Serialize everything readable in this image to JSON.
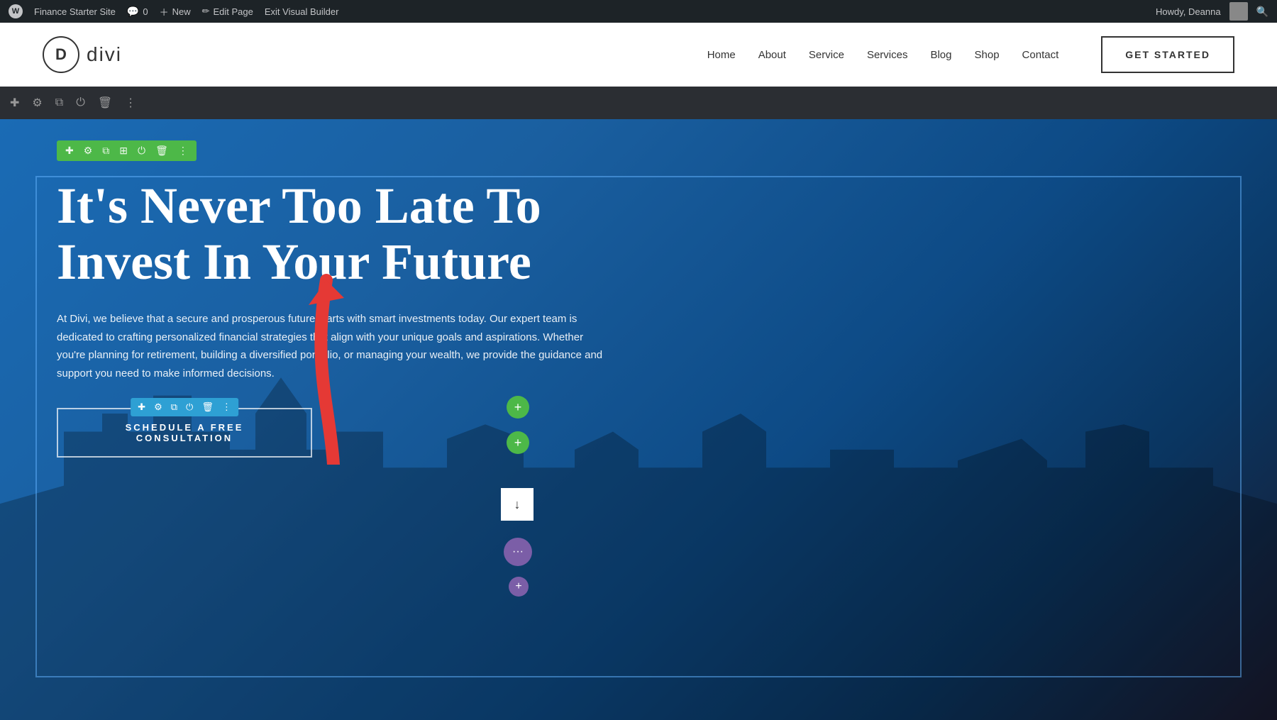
{
  "admin_bar": {
    "wp_icon": "W",
    "site_name": "Finance Starter Site",
    "comments_label": "0",
    "new_label": "New",
    "edit_page_label": "Edit Page",
    "exit_builder_label": "Exit Visual Builder",
    "howdy_label": "Howdy, Deanna"
  },
  "header": {
    "logo_letter": "D",
    "logo_text": "divi",
    "nav_items": [
      "Home",
      "About",
      "Service",
      "Services",
      "Blog",
      "Shop",
      "Contact"
    ],
    "cta_label": "GET STARTED"
  },
  "builder_bar": {
    "icons": [
      "plus",
      "gear",
      "copy",
      "power",
      "trash",
      "menu"
    ]
  },
  "hero": {
    "title": "It's Never Too Late To Invest In Your Future",
    "description": "At Divi, we believe that a secure and prosperous future starts with smart investments today. Our expert team is dedicated to crafting personalized financial strategies that align with your unique goals and aspirations. Whether you're planning for retirement, building a diversified portfolio, or managing your wealth, we provide the guidance and support you need to make informed decisions.",
    "cta_button_label": "SCHEDULE A FREE CONSULTATION",
    "row_toolbar_icons": [
      "plus",
      "gear",
      "copy",
      "columns",
      "power",
      "trash",
      "dots"
    ],
    "module_toolbar_icons": [
      "plus",
      "gear",
      "copy",
      "power",
      "trash",
      "dots"
    ]
  }
}
